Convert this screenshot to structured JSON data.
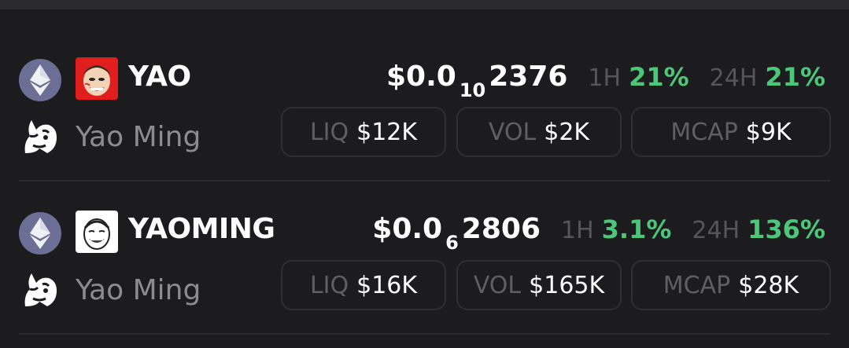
{
  "tokens": [
    {
      "symbol": "YAO",
      "name": "Yao Ming",
      "chain_icon": "ethereum-icon",
      "dex_icon": "uniswap-unicorn-icon",
      "price_prefix": "$0.0",
      "price_zeros": "10",
      "price_digits": "2376",
      "change_1h_label": "1H",
      "change_1h": "21%",
      "change_24h_label": "24H",
      "change_24h": "21%",
      "liq_label": "LIQ",
      "liq": "$12K",
      "vol_label": "VOL",
      "vol": "$2K",
      "mcap_label": "MCAP",
      "mcap": "$9K",
      "image_bg": "#e01e1e"
    },
    {
      "symbol": "YAOMING",
      "name": "Yao Ming",
      "chain_icon": "ethereum-icon",
      "dex_icon": "uniswap-unicorn-icon",
      "price_prefix": "$0.0",
      "price_zeros": "6",
      "price_digits": "2806",
      "change_1h_label": "1H",
      "change_1h": "3.1%",
      "change_24h_label": "24H",
      "change_24h": "136%",
      "liq_label": "LIQ",
      "liq": "$16K",
      "vol_label": "VOL",
      "vol": "$165K",
      "mcap_label": "MCAP",
      "mcap": "$28K",
      "image_bg": "#ffffff"
    }
  ],
  "colors": {
    "background": "#1c1c1f",
    "positive": "#4cc77a",
    "muted": "#8c8c90",
    "ethereum": "#6b6f95"
  }
}
